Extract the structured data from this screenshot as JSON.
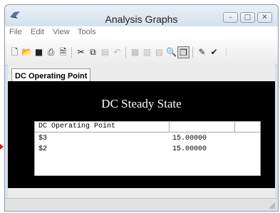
{
  "window": {
    "title": "Analysis Graphs"
  },
  "menu": [
    "File",
    "Edit",
    "View",
    "Tools"
  ],
  "tab": {
    "label": "DC Operating Point"
  },
  "graph": {
    "title": "DC Steady State"
  },
  "table": {
    "header": "DC Operating Point",
    "rows": [
      {
        "name": "$3",
        "value": "15.00000"
      },
      {
        "name": "$2",
        "value": "15.00000"
      }
    ]
  },
  "colors": {
    "graph_background": "#000000",
    "marker": "#e41010"
  }
}
